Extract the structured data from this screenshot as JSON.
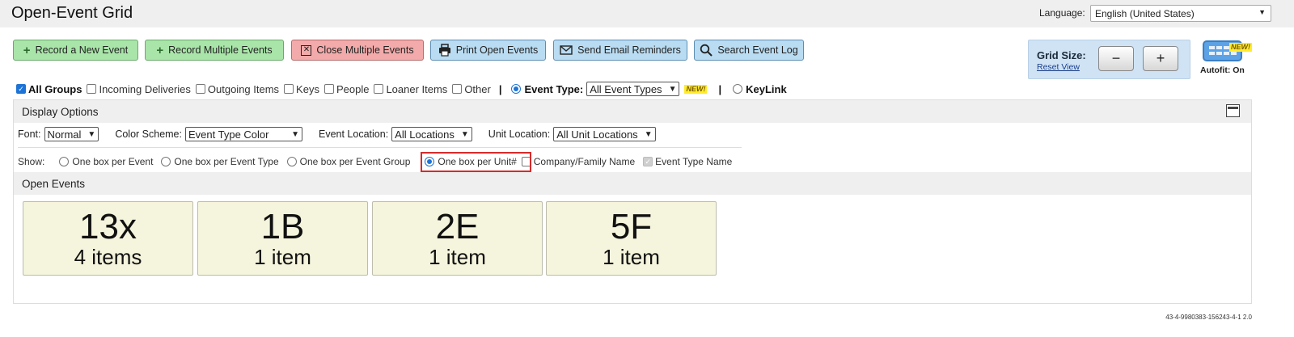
{
  "header": {
    "title": "Open-Event Grid",
    "language_label": "Language:",
    "language_value": "English (United States)"
  },
  "toolbar": {
    "record_new": "Record a New Event",
    "record_multiple": "Record Multiple Events",
    "close_multiple": "Close Multiple Events",
    "print_open": "Print Open Events",
    "send_reminders": "Send Email Reminders",
    "search_log": "Search Event Log"
  },
  "grid_size": {
    "label": "Grid Size:",
    "reset": "Reset View",
    "minus": "−",
    "plus": "+",
    "autofit": "Autofit: On",
    "new_badge": "NEW!"
  },
  "filters": {
    "all_groups": "All Groups",
    "incoming": "Incoming Deliveries",
    "outgoing": "Outgoing Items",
    "keys": "Keys",
    "people": "People",
    "loaner": "Loaner Items",
    "other": "Other",
    "separator": "|",
    "event_type_label": "Event Type:",
    "event_type_value": "All Event Types",
    "new_badge": "NEW!",
    "keylink": "KeyLink"
  },
  "display_options": {
    "title": "Display Options",
    "font_label": "Font:",
    "font_value": "Normal",
    "color_label": "Color Scheme:",
    "color_value": "Event Type Color",
    "location_label": "Event Location:",
    "location_value": "All Locations",
    "unit_label": "Unit Location:",
    "unit_value": "All Unit Locations",
    "show_label": "Show:",
    "opt_event": "One box per Event",
    "opt_event_type": "One box per Event Type",
    "opt_event_group": "One box per Event Group",
    "opt_unit": "One box per Unit#",
    "company_name": "Company/Family Name",
    "event_type_name": "Event Type Name"
  },
  "open_events": {
    "title": "Open Events",
    "cards": [
      {
        "unit": "13x",
        "count": "4 items"
      },
      {
        "unit": "1B",
        "count": "1 item"
      },
      {
        "unit": "2E",
        "count": "1 item"
      },
      {
        "unit": "5F",
        "count": "1 item"
      }
    ]
  },
  "footer": {
    "version": "43-4-9980383-156243-4-1 2.0"
  },
  "colors": {
    "green_button": "#a9e5a9",
    "red_button": "#f3aaaa",
    "blue_button": "#b9dcf2",
    "card_background": "#f5f4dc",
    "highlight": "#d62b2b"
  }
}
